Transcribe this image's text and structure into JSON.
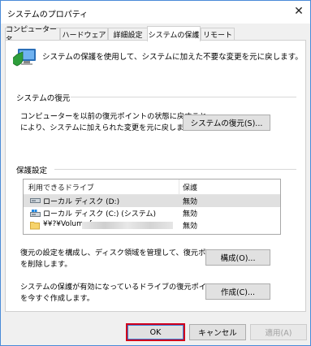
{
  "window": {
    "title": "システムのプロパティ",
    "close_glyph": "✕"
  },
  "tabs": [
    {
      "label": "コンピューター名"
    },
    {
      "label": "ハードウェア"
    },
    {
      "label": "詳細設定"
    },
    {
      "label": "システムの保護"
    },
    {
      "label": "リモート"
    }
  ],
  "intro": {
    "text": "システムの保護を使用して、システムに加えた不要な変更を元に戻します。",
    "icon": "system-protection-icon"
  },
  "restore": {
    "group_title": "システムの復元",
    "description_line1": "コンピューターを以前の復元ポイントの状態に戻すこと",
    "description_line2": "により、システムに加えられた変更を元に戻します。",
    "button_label": "システムの復元(S)..."
  },
  "protection": {
    "group_title": "保護設定",
    "columns": {
      "drive": "利用できるドライブ",
      "protection": "保護"
    },
    "drives": [
      {
        "name": "ローカル ディスク (D:)",
        "status": "無効",
        "icon": "drive-icon"
      },
      {
        "name": "ローカル ディスク (C:) (システム)",
        "status": "無効",
        "icon": "system-drive-icon"
      },
      {
        "name": "¥¥?¥Volume{",
        "status": "無効",
        "icon": "folder-icon"
      }
    ],
    "configure_desc_line1": "復元の設定を構成し、ディスク領域を管理して、復元ポイント",
    "configure_desc_line2": "を削除します。",
    "configure_button": "構成(O)...",
    "create_desc_line1": "システムの保護が有効になっているドライブの復元ポイント",
    "create_desc_line2": "を今すぐ作成します。",
    "create_button": "作成(C)..."
  },
  "footer": {
    "ok": "OK",
    "cancel": "キャンセル",
    "apply": "適用(A)"
  },
  "colors": {
    "window_border": "#4a8bd8",
    "focus_highlight": "#d1001c"
  }
}
